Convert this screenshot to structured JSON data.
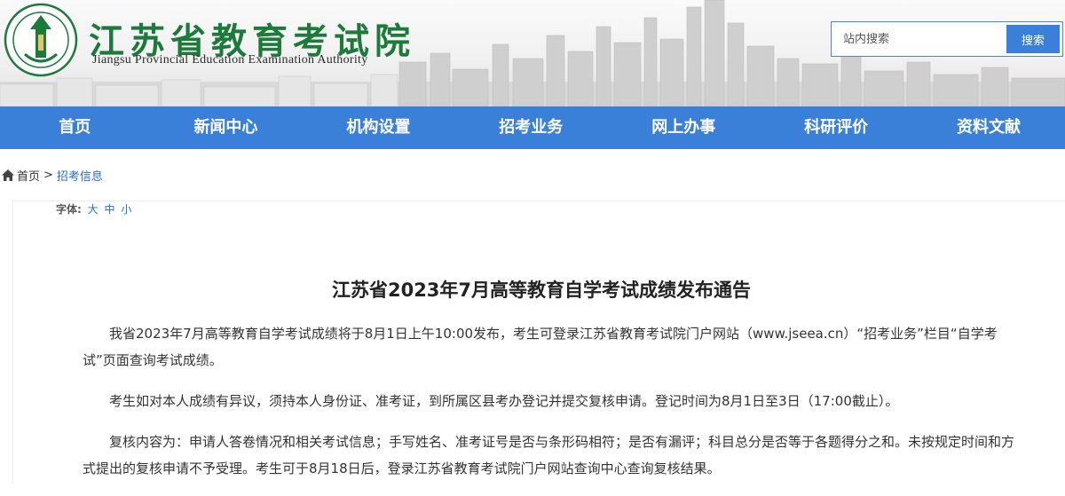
{
  "header": {
    "site_name": "江苏省教育考试院",
    "site_name_en": "Jiangsu Provincial Education Examination Authority",
    "logo_text": "江苏省教育考试院",
    "search": {
      "placeholder": "站内搜索",
      "button_label": "搜索"
    }
  },
  "nav": {
    "items": [
      "首页",
      "新闻中心",
      "机构设置",
      "招考业务",
      "网上办事",
      "科研评价",
      "资料文献"
    ]
  },
  "breadcrumb": {
    "home": "首页",
    "separator": ">",
    "current": "招考信息"
  },
  "article": {
    "font_label": "字体:",
    "font_options": [
      "大",
      "中",
      "小"
    ],
    "title": "江苏省2023年7月高等教育自学考试成绩发布通告",
    "paragraphs": [
      "我省2023年7月高等教育自学考试成绩将于8月1日上午10:00发布，考生可登录江苏省教育考试院门户网站（www.jseea.cn）“招考业务”栏目“自学考试”页面查询考试成绩。",
      "考生如对本人成绩有异议，须持本人身份证、准考证，到所属区县考办登记并提交复核申请。登记时间为8月1日至3日（17:00截止）。",
      "复核内容为：申请人答卷情况和相关考试信息；手写姓名、准考证号是否与条形码相符；是否有漏评；科目总分是否等于各题得分之和。未按规定时间和方式提出的复核申请不予受理。考生可于8月18日后，登录江苏省教育考试院门户网站查询中心查询复核结果。"
    ]
  },
  "colors": {
    "nav": "#3a80d8",
    "brand_green": "#1c7a3a",
    "link_blue": "#2a6fc9"
  }
}
